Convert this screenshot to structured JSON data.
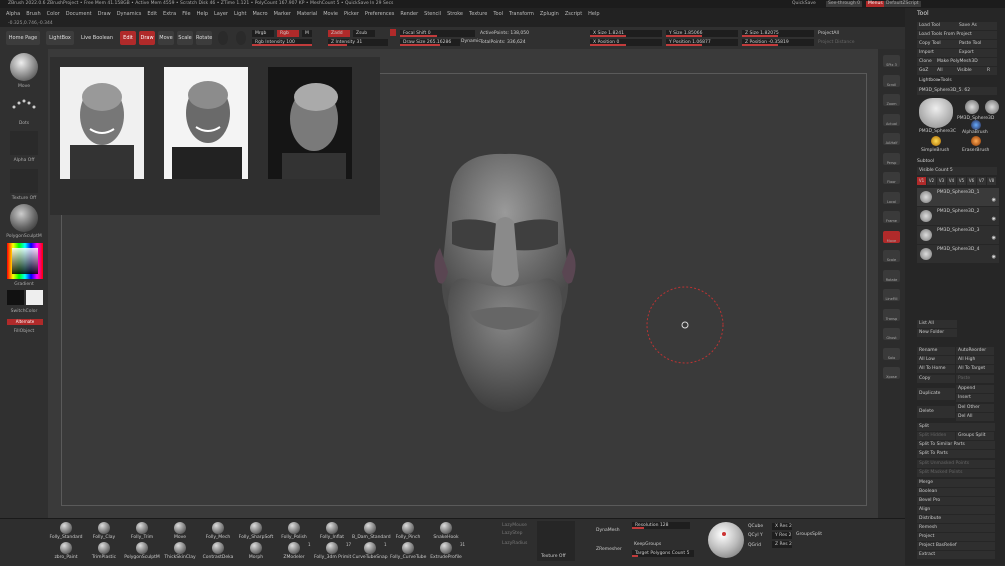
{
  "titlebar": {
    "text": "ZBrush 2022.0.6   ZBrushProject   • Free Mem 41.158GB • Active Mem 4559 • Scratch Disk 46 • ZTime 1.121 • PolyCount 167.907 KP • MeshCount 5 • QuickSave In 29 Secs"
  },
  "titlebar_right": {
    "quicksave": "QuickSave",
    "seethrough": "See-through 0",
    "menus": "Menus",
    "layout": "DefaultZScript"
  },
  "menubar": {
    "items": [
      "Alpha",
      "Brush",
      "Color",
      "Document",
      "Draw",
      "Dynamics",
      "Edit",
      "Extra",
      "File",
      "Help",
      "Layer",
      "Light",
      "Macro",
      "Marker",
      "Material",
      "Movie",
      "Picker",
      "Preferences",
      "Render",
      "Stencil",
      "Stroke",
      "Texture",
      "Tool",
      "Transform",
      "Zplugin",
      "Zscript",
      "Help"
    ]
  },
  "status": {
    "text": "-0.325,0.746,-0.344"
  },
  "topbar": {
    "home_page": "Home Page",
    "lightbox": "LightBox",
    "live_boolean": "Live Boolean",
    "edit": "Edit",
    "draw": "Draw",
    "move": "Move",
    "scale": "Scale",
    "rotate": "Rotate",
    "mrgb": "Mrgb",
    "rgb": "Rgb",
    "m": "M",
    "zadd": "Zadd",
    "zsub": "Zsub",
    "rgb_intensity": "Rgb Intensity 100",
    "z_intensity": "Z Intensity 31",
    "focal_shift": "Focal Shift 0",
    "draw_size": "Draw Size 265.16286",
    "dynamic": "Dynamic",
    "active_points": "ActivePoints: 138,050",
    "total_points": "TotalPoints: 336,624",
    "x_size": "X Size 1.8241",
    "y_size": "Y Size 1.85066",
    "z_size": "Z Size 1.82075",
    "x_pos": "X Position 0",
    "y_pos": "Y Position 1.06877",
    "z_pos": "Z Position -0.35819",
    "project_all": "ProjectAll",
    "project_distance": "Project Distance"
  },
  "leftshelf": {
    "move": "Move",
    "dots": "Dots",
    "alpha_off": "Alpha Off",
    "texture_off": "Texture Off",
    "material": "PolygonSculptM",
    "gradient": "Gradient",
    "switchcolor": "SwitchColor",
    "alternate": "Alternate",
    "fill": "FillObject"
  },
  "rightshelf": [
    "SPix 3",
    "Scroll",
    "Zoom",
    "Actual",
    "AAHalf",
    "Persp",
    "Floor",
    "Local",
    "Frame",
    "Move",
    "Scale",
    "Rotate",
    "LineFill",
    "Transp",
    "Ghost",
    "Solo",
    "Xpose"
  ],
  "tray": {
    "title": "Tool",
    "load_tool": "Load Tool",
    "save_as": "Save As",
    "load_from_project": "Load Tools From Project",
    "copy_tool": "Copy Tool",
    "paste_tool": "Paste Tool",
    "import": "Import",
    "export": "Export",
    "clone": "Clone",
    "make_polymesh": "Make PolyMesh3D",
    "goz": "GoZ",
    "all": "All",
    "visible": "Visible",
    "r": "R",
    "lightbox_tools": "Lightbox▸Tools",
    "current_tool": "PM3D_Sphere3D_5.  62",
    "thumbs": [
      "PM3D_Sphere3C",
      "PM3D_Sphere3D",
      "AlphaBrush",
      "SimpleBrush",
      "EraserBrush"
    ],
    "subtool": "Subtool",
    "visible_count": "Visible Count 5",
    "v_levels": [
      "V1",
      "V2",
      "V3",
      "V4",
      "V5",
      "V6",
      "V7",
      "V8"
    ],
    "subtools": [
      "PM3D_Sphere3D_1",
      "PM3D_Sphere3D_2",
      "PM3D_Sphere3D_3",
      "PM3D_Sphere3D_4"
    ],
    "list_all": "List All",
    "new_folder": "New Folder",
    "rename": "Rename",
    "autoreorder": "AutoReorder",
    "all_low": "All Low",
    "all_high": "All High",
    "all_to_home": "All To Home",
    "all_to_target": "All To Target",
    "copy": "Copy",
    "paste": "Paste",
    "duplicate": "Duplicate",
    "append": "Append",
    "insert": "Insert",
    "delete": "Delete",
    "del_other": "Del Other",
    "del_all": "Del All",
    "split": "Split",
    "split_hidden": "Split Hidden",
    "groups_split": "Groups Split",
    "split_similar": "Split To Similar Parts",
    "split_parts": "Split To Parts",
    "split_unmasked": "Split Unmasked Points",
    "split_masked": "Split Masked Points",
    "merge": "Merge",
    "boolean": "Boolean",
    "bevel_pro": "Bevel Pro",
    "align": "Align",
    "distribute": "Distribute",
    "remesh": "Remesh",
    "project": "Project",
    "project_bas_relief": "Project BasRelief",
    "extract": "Extract"
  },
  "bottom": {
    "brushes_top": [
      "Folly_Standard",
      "Folly_Clay",
      "Folly_Trim",
      "Move",
      "Folly_Mech",
      "Folly_SharpSoft",
      "Folly_Polish",
      "Folly_Inflat",
      "B_Dam_Standard",
      "Folly_Pinch",
      "SnakeHook"
    ],
    "brushes_bottom": [
      "zbro_Paint",
      "TrimPlastic",
      "PolygonSculptM",
      "ThickSkinClay",
      "ContrastDeka",
      "Morph",
      "ZModeler",
      "Folly_3dm Primit",
      "CurveTubeSnap",
      "Folly_CurveTube",
      "ExtrudeProfile"
    ],
    "counts": [
      "1",
      "17",
      "1",
      "31"
    ],
    "lazy_mouse": "LazyMouse",
    "lazy_radius": "LazyRadius",
    "lazy_step": "LazyStep",
    "texture_off": "Texture Off",
    "dynamesh": "DynaMesh",
    "resolution": "Resolution 128",
    "zremesher": "ZRemesher",
    "keep_groups": "KeepGroups",
    "target_count": "Target Polygons Count 5",
    "qcube": "QCube",
    "qcyl": "QCyl Y",
    "qgrid": "QGrid",
    "xres": "X Res 2",
    "yres": "Y Res 2",
    "zres": "Z Res 2",
    "group_as_dynamesh": "GroupsSplit"
  },
  "colors": {
    "accent": "#c13b3b",
    "bg": "#2b2b2b",
    "canvas": "#3a3a3a"
  }
}
